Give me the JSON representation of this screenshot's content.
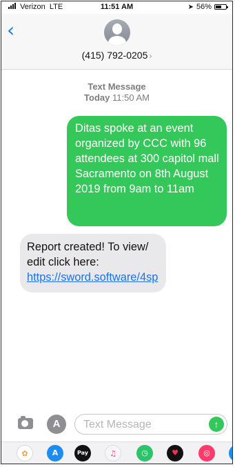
{
  "status_bar": {
    "carrier": "Verizon",
    "network": "LTE",
    "time": "11:51 AM",
    "battery_percent": "56%",
    "battery_level": 0.56
  },
  "header": {
    "back_icon": "chevron-left-icon",
    "contact_number": "(415) 792-0205",
    "contact_chevron": "›"
  },
  "conversation": {
    "message_type": "Text Message",
    "timestamp_day": "Today",
    "timestamp_time": "11:50 AM",
    "messages": [
      {
        "direction": "sent",
        "text": "Ditas spoke at an event organized by CCC with 96 attendees at 300 capitol mall Sacramento on 8th August 2019 from 9am to 11am"
      },
      {
        "direction": "received",
        "text_before_link": "Report created! To view/ edit click here: ",
        "link": "https://sword.software/4sp"
      }
    ]
  },
  "compose": {
    "placeholder": "Text Message",
    "send_glyph": "↑",
    "appstore_glyph": "A"
  },
  "app_drawer": {
    "pay_label": "Pay"
  },
  "colors": {
    "sent_bubble": "#34c759",
    "received_bubble": "#e9e9eb",
    "link": "#1a73e8",
    "accent": "#1a7bf2"
  }
}
